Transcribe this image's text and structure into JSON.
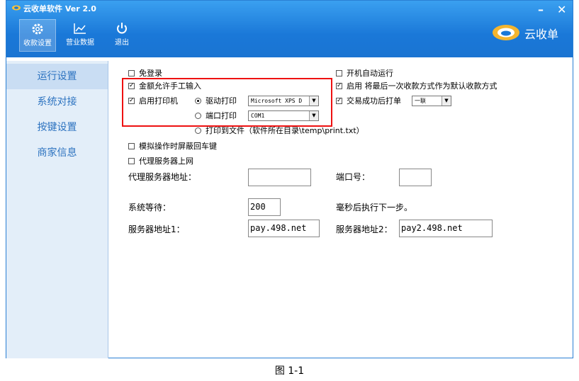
{
  "titlebar": {
    "title": "云收单软件 Ver 2.0",
    "minimize": "–",
    "close": "✕"
  },
  "toolbar": {
    "items": [
      {
        "label": "收款设置",
        "icon": "gear-icon"
      },
      {
        "label": "营业数据",
        "icon": "chart-icon"
      },
      {
        "label": "退出",
        "icon": "power-icon"
      }
    ],
    "brand": "云收单"
  },
  "sidebar": {
    "items": [
      {
        "label": "运行设置"
      },
      {
        "label": "系统对接"
      },
      {
        "label": "按键设置"
      },
      {
        "label": "商家信息"
      }
    ]
  },
  "settings": {
    "free_login": {
      "label": "免登录",
      "checked": false
    },
    "manual_amount": {
      "label": "金额允许手工输入",
      "checked": true
    },
    "enable_printer": {
      "label": "启用打印机",
      "checked": true
    },
    "driver_print": {
      "label": "驱动打印",
      "selected": true
    },
    "driver_value": "Microsoft XPS D",
    "port_print": {
      "label": "端口打印",
      "selected": false
    },
    "port_value": "COM1",
    "print_to_file": {
      "label": "打印到文件（软件所在目录\\temp\\print.txt）",
      "selected": false
    },
    "simulate_enter": {
      "label": "模拟操作时屏蔽回车键",
      "checked": false
    },
    "proxy_internet": {
      "label": "代理服务器上网",
      "checked": false
    },
    "proxy_address_label": "代理服务器地址：",
    "proxy_address_value": "",
    "port_label": "端口号：",
    "port_number_value": "",
    "wait_label": "系统等待：",
    "wait_value": "200",
    "wait_suffix": "毫秒后执行下一步。",
    "server1_label": "服务器地址1：",
    "server1_value": "pay.498.net",
    "server2_label": "服务器地址2：",
    "server2_value": "pay2.498.net",
    "autostart": {
      "label": "开机自动运行",
      "checked": false
    },
    "last_method": {
      "label": "启用 将最后一次收款方式作为默认收款方式",
      "checked": true
    },
    "print_after": {
      "label": "交易成功后打单",
      "checked": true
    },
    "copies_value": "一联"
  },
  "caption": "图 1-1",
  "colors": {
    "titlebar": "#1a78d8",
    "sidebar": "#e3eef9",
    "highlight": "#e11111",
    "sidebar_text": "#2d73c0"
  }
}
